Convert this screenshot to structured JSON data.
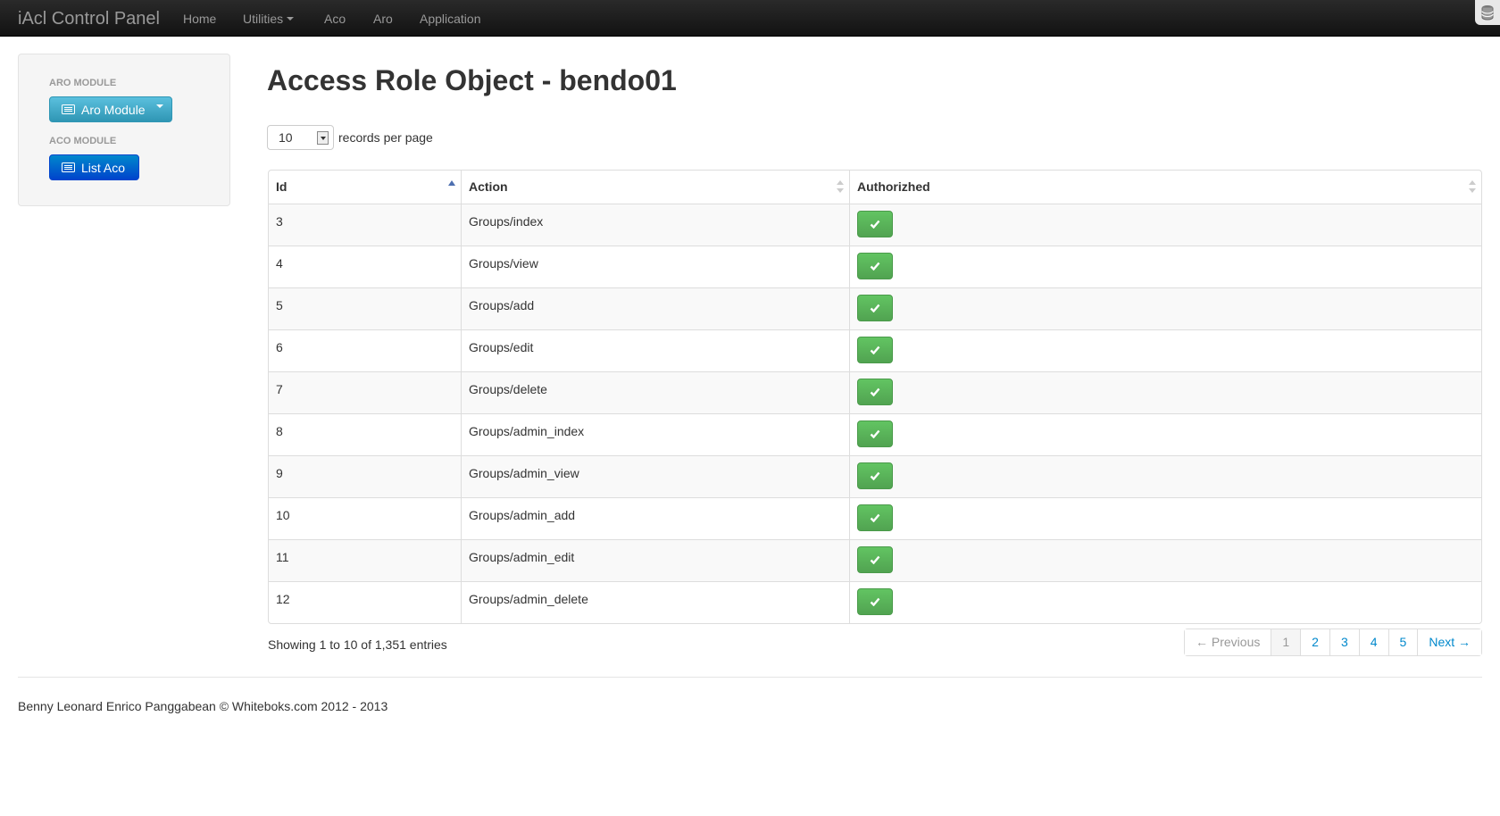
{
  "navbar": {
    "brand": "iAcl Control Panel",
    "items": [
      {
        "label": "Home"
      },
      {
        "label": "Utilities"
      },
      {
        "label": "Aco"
      },
      {
        "label": "Aro"
      },
      {
        "label": "Application"
      }
    ]
  },
  "sidebar": {
    "aro_header": "ARO MODULE",
    "aro_button": "Aro Module",
    "aco_header": "ACO MODULE",
    "aco_button": "List Aco"
  },
  "main": {
    "title": "Access Role Object - bendo01",
    "per_page_value": "10",
    "per_page_label": "records per page",
    "columns": [
      "Id",
      "Action",
      "Authorizhed"
    ],
    "rows": [
      {
        "id": "3",
        "action": "Groups/index",
        "authorized": true
      },
      {
        "id": "4",
        "action": "Groups/view",
        "authorized": true
      },
      {
        "id": "5",
        "action": "Groups/add",
        "authorized": true
      },
      {
        "id": "6",
        "action": "Groups/edit",
        "authorized": true
      },
      {
        "id": "7",
        "action": "Groups/delete",
        "authorized": true
      },
      {
        "id": "8",
        "action": "Groups/admin_index",
        "authorized": true
      },
      {
        "id": "9",
        "action": "Groups/admin_view",
        "authorized": true
      },
      {
        "id": "10",
        "action": "Groups/admin_add",
        "authorized": true
      },
      {
        "id": "11",
        "action": "Groups/admin_edit",
        "authorized": true
      },
      {
        "id": "12",
        "action": "Groups/admin_delete",
        "authorized": true
      }
    ],
    "info": "Showing 1 to 10 of 1,351 entries",
    "pagination": {
      "previous": "← Previous",
      "pages": [
        "1",
        "2",
        "3",
        "4",
        "5"
      ],
      "current": "1",
      "next": "Next →"
    }
  },
  "footer": "Benny Leonard Enrico Panggabean © Whiteboks.com 2012 - 2013",
  "colors": {
    "navbar": "#1b1b1b",
    "info_button": "#49afcd",
    "primary_button": "#0066cc",
    "success_button": "#5bb75b",
    "link": "#0088cc"
  },
  "icons": {
    "button_icon": "list-alt-icon",
    "check_icon": "checkmark-icon",
    "corner_icon": "database-icon"
  }
}
